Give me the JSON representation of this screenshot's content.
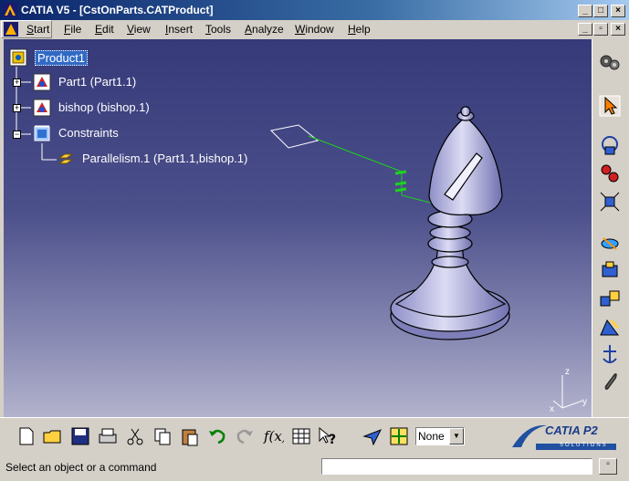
{
  "window": {
    "title": "CATIA V5 - [CstOnParts.CATProduct]"
  },
  "menubar": {
    "items": [
      {
        "label": "Start",
        "u": "S",
        "rest": "tart"
      },
      {
        "label": "File",
        "u": "F",
        "rest": "ile"
      },
      {
        "label": "Edit",
        "u": "E",
        "rest": "dit"
      },
      {
        "label": "View",
        "u": "V",
        "rest": "iew"
      },
      {
        "label": "Insert",
        "u": "I",
        "rest": "nsert"
      },
      {
        "label": "Tools",
        "u": "T",
        "rest": "ools"
      },
      {
        "label": "Analyze",
        "u": "A",
        "rest": "nalyze"
      },
      {
        "label": "Window",
        "u": "W",
        "rest": "indow"
      },
      {
        "label": "Help",
        "u": "H",
        "rest": "elp"
      }
    ]
  },
  "tree": {
    "root": "Product1",
    "items": [
      "Part1 (Part1.1)",
      "bishop (bishop.1)",
      "Constraints"
    ],
    "constraint": "Parallelism.1 (Part1.1,bishop.1)"
  },
  "compass": {
    "x": "x",
    "y": "y",
    "z": "z"
  },
  "toolbar": {
    "render_style_value": "None"
  },
  "brand": {
    "logo_top": "CATIA P2",
    "logo_bottom": "SOLUTIONS"
  },
  "status": {
    "message": "Select an object or a command"
  },
  "colors": {
    "title_start": "#0a246a",
    "viewport_top": "#363a79",
    "viewport_bottom": "#b3b3cd",
    "constraint_green": "#1fd11f",
    "tree_text": "#ffffff"
  }
}
